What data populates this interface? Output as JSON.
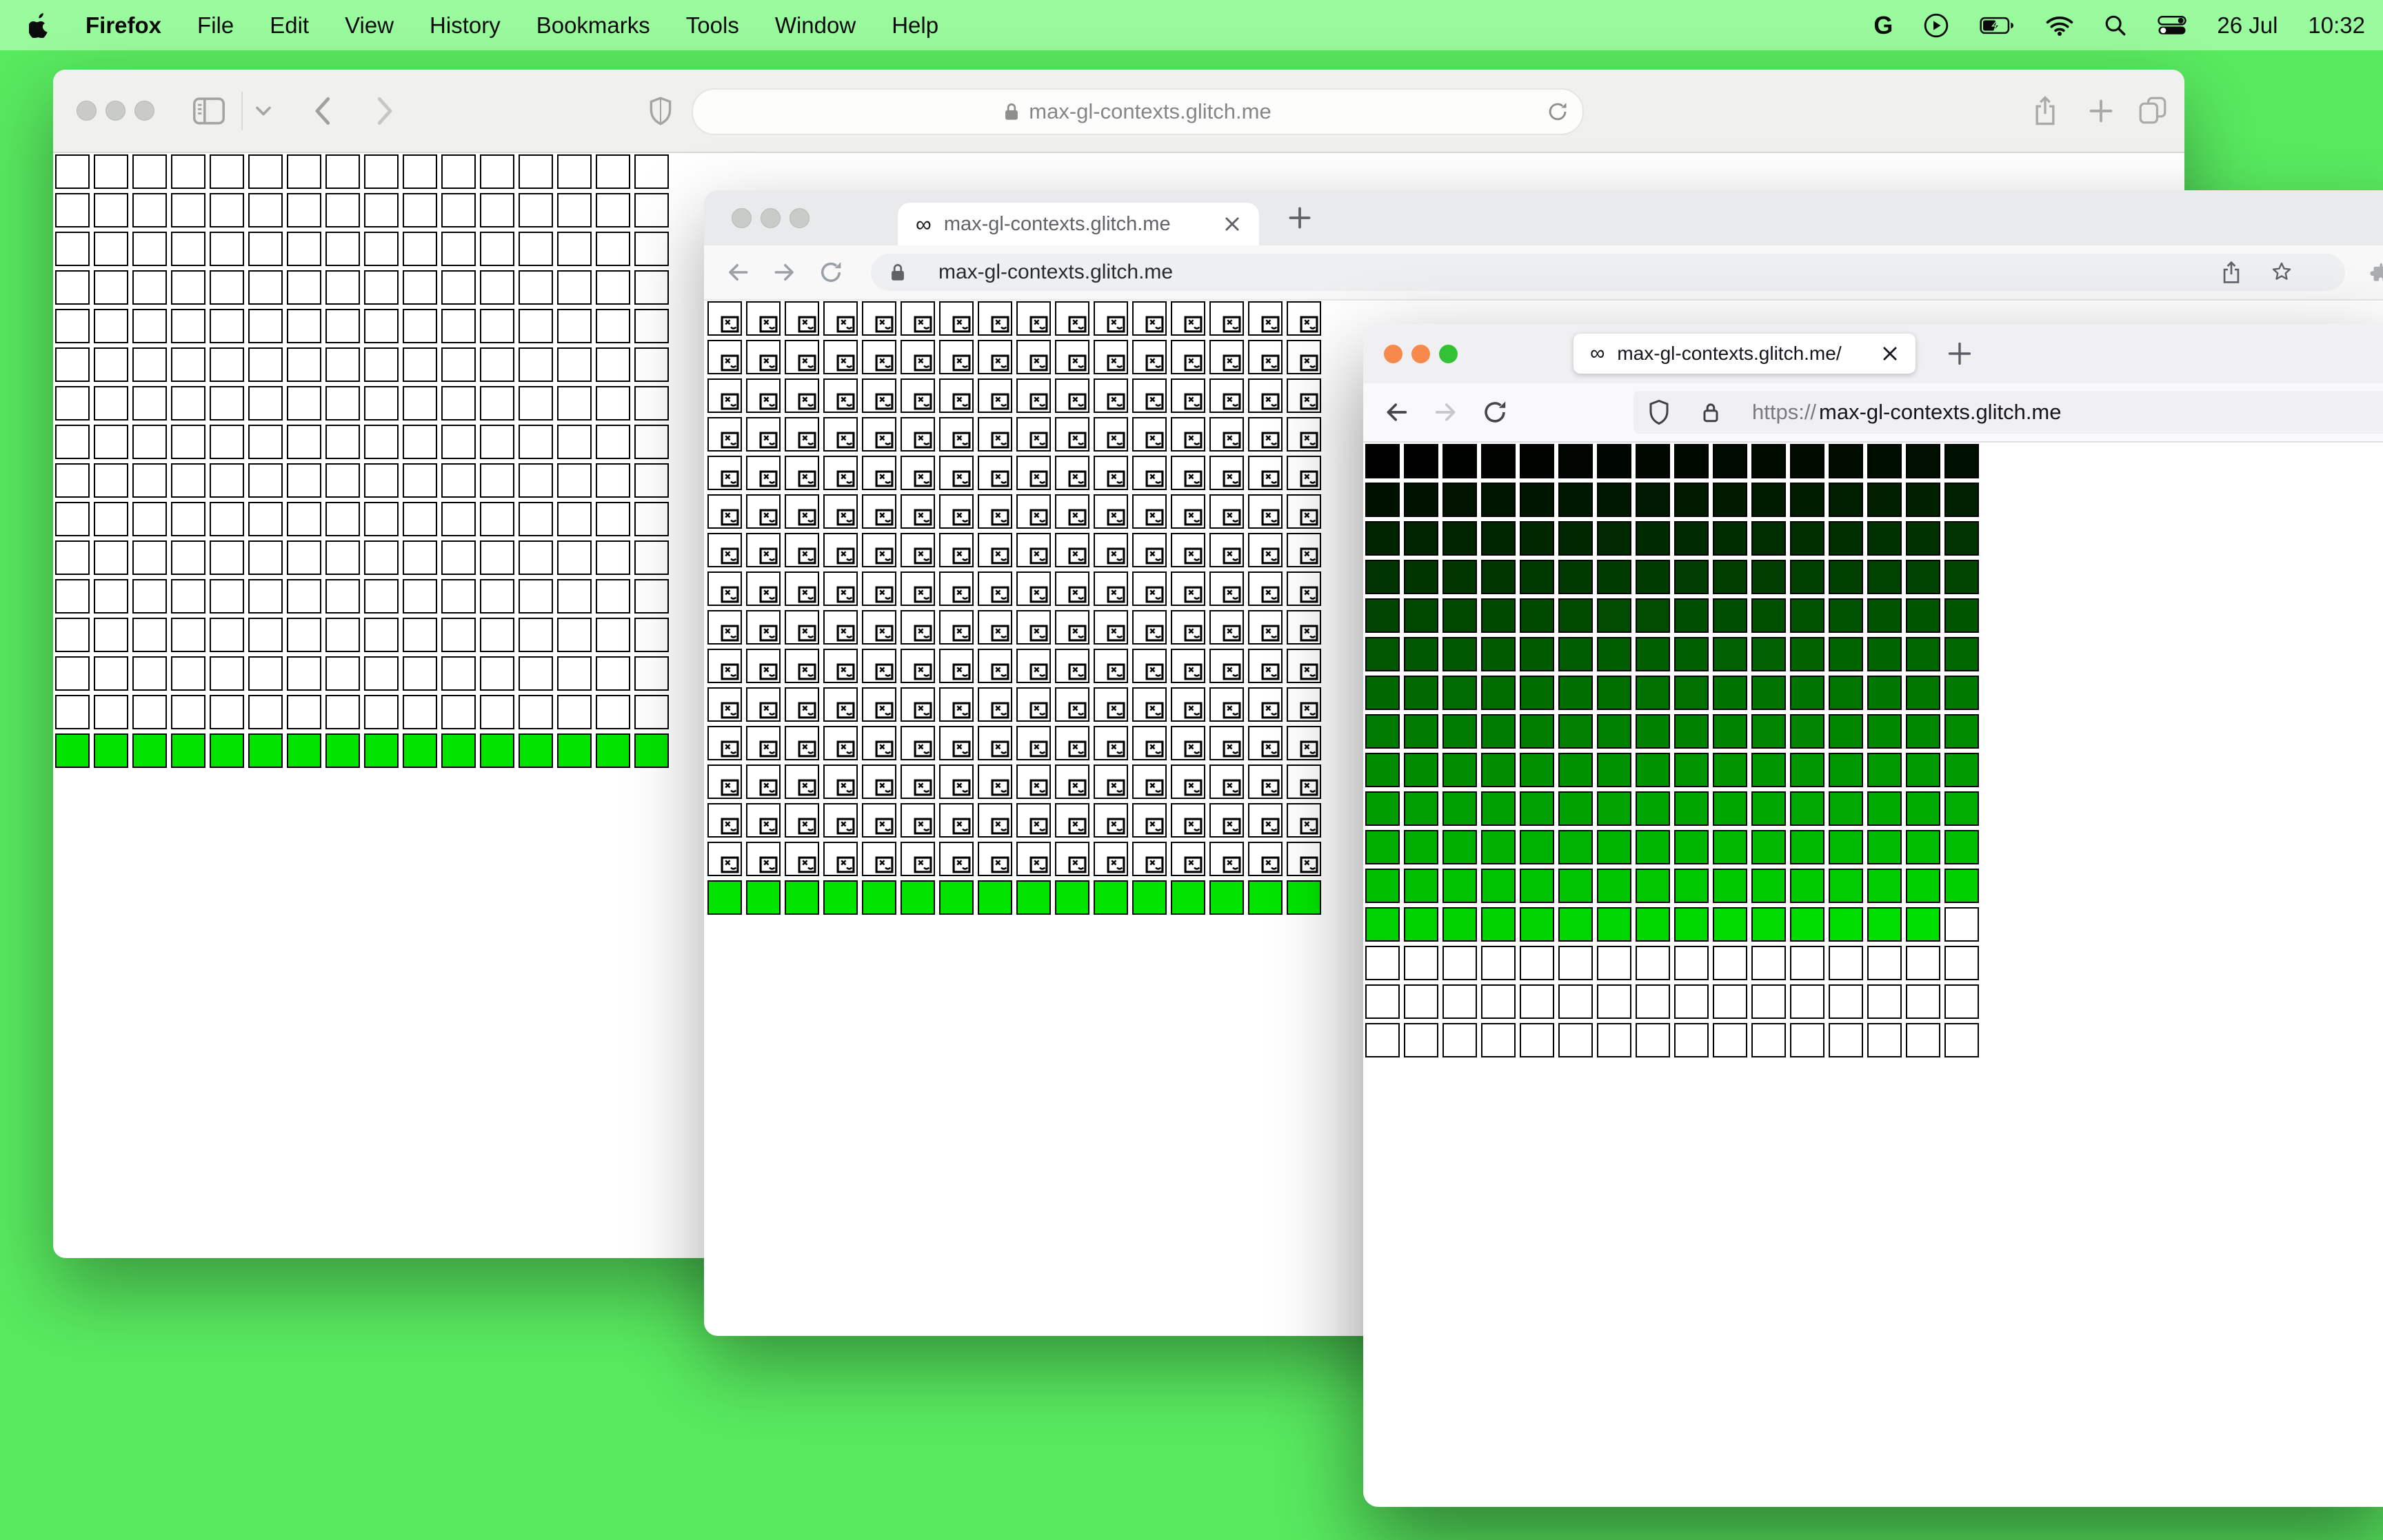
{
  "menu_bar": {
    "app_name": "Firefox",
    "items": [
      "File",
      "Edit",
      "View",
      "History",
      "Bookmarks",
      "Tools",
      "Window",
      "Help"
    ],
    "status": {
      "google_label": "G",
      "date": "26 Jul",
      "time": "10:32"
    }
  },
  "safari_window": {
    "url": "max-gl-contexts.glitch.me",
    "grid": {
      "cols": 16,
      "rows": 16,
      "empty_rows": 15,
      "complete_row_color": "#00e400",
      "cell_border_color": "#000000",
      "empty_cell_color": "#ffffff"
    }
  },
  "chrome_window": {
    "tab_title": "max-gl-contexts.glitch.me",
    "tab_favicon": "∞",
    "url": "max-gl-contexts.glitch.me",
    "grid": {
      "cols": 16,
      "rows": 16,
      "broken_image_rows": 15,
      "complete_row_color": "#00e400",
      "cell_border_color": "#000000",
      "broken_cell_color": "#ffffff"
    }
  },
  "firefox_window": {
    "tab_title": "max-gl-contexts.glitch.me/",
    "tab_favicon": "∞",
    "url_scheme": "https://",
    "url_host": "max-gl-contexts.glitch.me",
    "traffic_lights": [
      "#f6894b",
      "#f6894b",
      "#33c233"
    ],
    "grid": {
      "cols": 16,
      "rows": 16,
      "gradient_full_rows": 12,
      "gradient_cells_in_partial_row": 15,
      "empty_rows": 3,
      "total_gradient_cells": 207,
      "gradient_start": "rgb(0,0,0)",
      "gradient_end": "rgb(0,224,0)",
      "cell_border_color": "#000000",
      "empty_cell_color": "#ffffff"
    }
  },
  "colors": {
    "desktop": "#58ea5f",
    "menu_bar_bg": "#9afb9e",
    "safari_toolbar_bg": "#f0f1ee",
    "chrome_tabstrip_bg": "#e8eaec",
    "firefox_titlebar_bg": "#f0f0f3",
    "complete_green": "#00e400"
  }
}
